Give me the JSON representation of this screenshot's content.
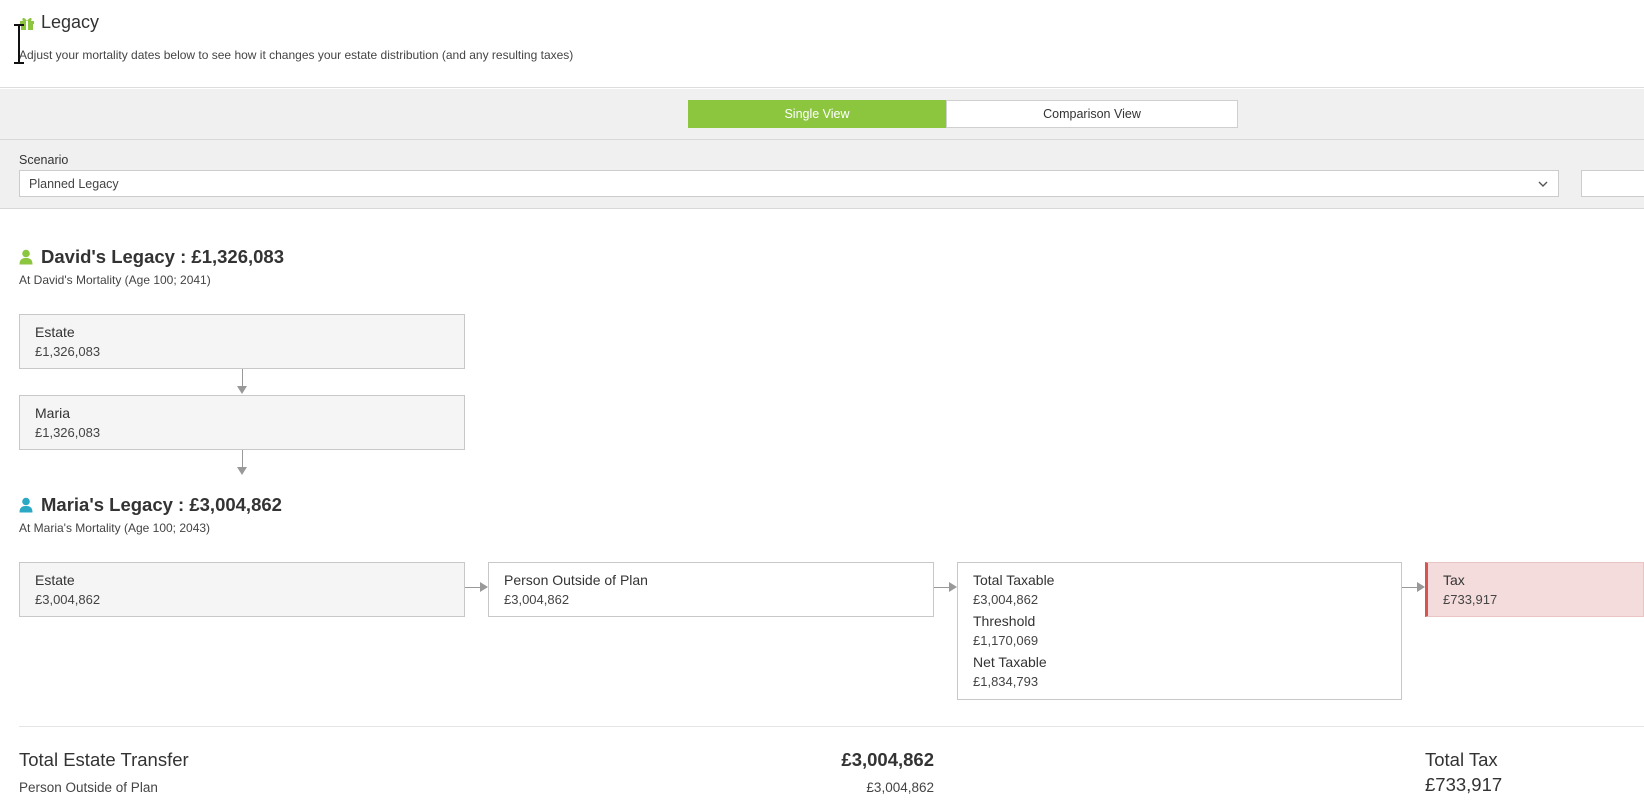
{
  "header": {
    "title": "Legacy",
    "subtitle": "Adjust your mortality dates below to see how it changes your estate distribution (and any resulting taxes)",
    "icon": "gift-icon",
    "icon_color": "#8cc63f"
  },
  "toolbar": {
    "view_toggle": {
      "single_label": "Single View",
      "comparison_label": "Comparison View",
      "active": "Single View",
      "active_color": "#8cc63f"
    },
    "scenario": {
      "label": "Scenario",
      "value": "Planned Legacy"
    }
  },
  "david": {
    "title": "David's Legacy : £1,326,083",
    "subtitle": "At David's Mortality (Age 100; 2041)",
    "icon_color": "#8cc63f",
    "estate": {
      "label": "Estate",
      "value": "£1,326,083"
    },
    "recipient": {
      "label": "Maria",
      "value": "£1,326,083"
    }
  },
  "maria": {
    "title": "Maria's Legacy : £3,004,862",
    "subtitle": "At Maria's Mortality (Age 100; 2043)",
    "icon_color": "#2aa8c4",
    "estate": {
      "label": "Estate",
      "value": "£3,004,862"
    },
    "recipient": {
      "label": "Person Outside of Plan",
      "value": "£3,004,862"
    },
    "taxable": {
      "total_label": "Total Taxable",
      "total_value": "£3,004,862",
      "threshold_label": "Threshold",
      "threshold_value": "£1,170,069",
      "net_label": "Net Taxable",
      "net_value": "£1,834,793"
    },
    "tax": {
      "label": "Tax",
      "value": "£733,917",
      "accent": "#d9534f"
    }
  },
  "summary": {
    "transfer_title": "Total Estate Transfer",
    "transfer_value": "£3,004,862",
    "rows": [
      {
        "label": "Person Outside of Plan",
        "value": "£3,004,862"
      }
    ],
    "tax_title": "Total Tax",
    "tax_value": "£733,917"
  }
}
